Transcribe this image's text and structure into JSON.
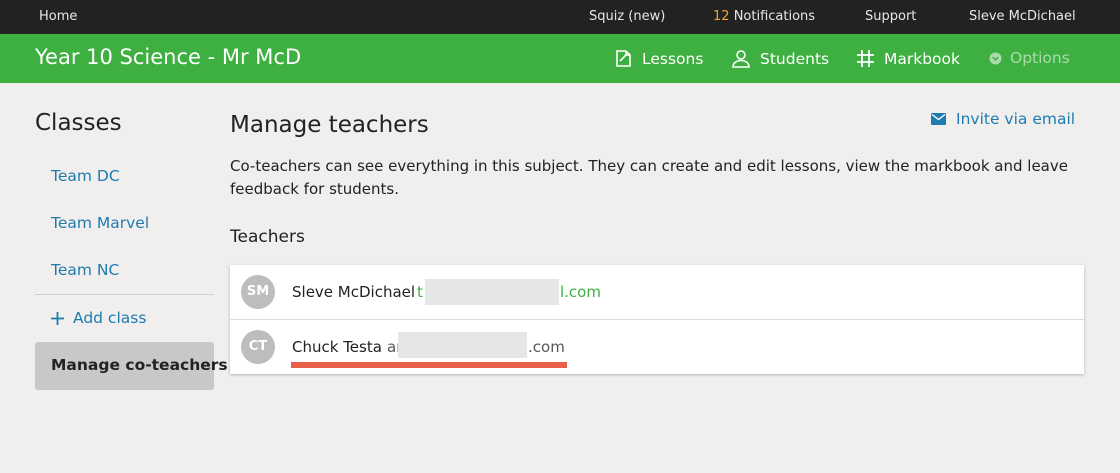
{
  "topbar": {
    "home": "Home",
    "squiz": "Squiz (new)",
    "notifications_count": "12",
    "notifications_label": "Notifications",
    "support": "Support",
    "user": "Sleve McDichael"
  },
  "header": {
    "title": "Year 10 Science - Mr McD",
    "nav": {
      "lessons": "Lessons",
      "students": "Students",
      "markbook": "Markbook",
      "options": "Options"
    }
  },
  "sidebar": {
    "heading": "Classes",
    "classes": [
      "Team DC",
      "Team Marvel",
      "Team NC"
    ],
    "add_class": "Add class",
    "active": "Manage co-teachers"
  },
  "main": {
    "title": "Manage teachers",
    "invite": "Invite via email",
    "description": "Co-teachers can see everything in this subject. They can create and edit lessons, view the markbook and leave feedback for students.",
    "section_heading": "Teachers",
    "teachers": [
      {
        "initials": "SM",
        "name": "Sleve McDichael",
        "email_start": "t",
        "email_end": "l.com",
        "email_color": "#3eb041"
      },
      {
        "initials": "CT",
        "name": "Chuck Testa",
        "email_start": "ar",
        "email_end": ".com",
        "email_color": "#555555"
      }
    ]
  },
  "colors": {
    "brand_green": "#3eb041",
    "link_blue": "#1e7bb0",
    "underline_red": "#e9604a"
  }
}
